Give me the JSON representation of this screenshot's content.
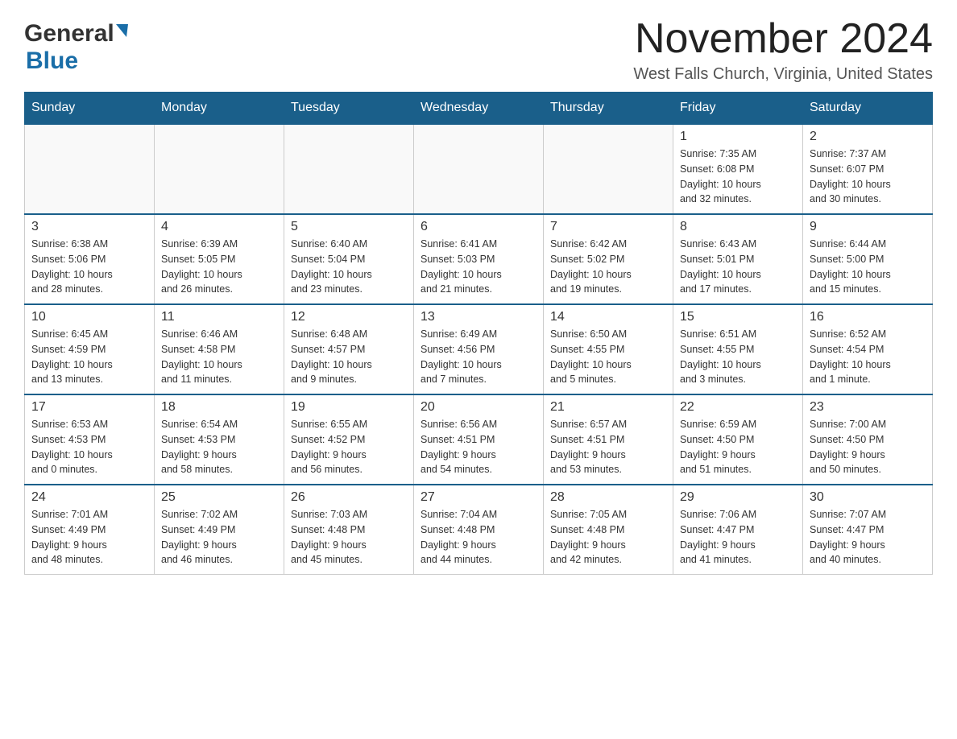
{
  "header": {
    "logo_general": "General",
    "logo_blue": "Blue",
    "month_title": "November 2024",
    "location": "West Falls Church, Virginia, United States"
  },
  "weekdays": [
    "Sunday",
    "Monday",
    "Tuesday",
    "Wednesday",
    "Thursday",
    "Friday",
    "Saturday"
  ],
  "weeks": [
    {
      "days": [
        {
          "date": "",
          "info": ""
        },
        {
          "date": "",
          "info": ""
        },
        {
          "date": "",
          "info": ""
        },
        {
          "date": "",
          "info": ""
        },
        {
          "date": "",
          "info": ""
        },
        {
          "date": "1",
          "info": "Sunrise: 7:35 AM\nSunset: 6:08 PM\nDaylight: 10 hours\nand 32 minutes."
        },
        {
          "date": "2",
          "info": "Sunrise: 7:37 AM\nSunset: 6:07 PM\nDaylight: 10 hours\nand 30 minutes."
        }
      ]
    },
    {
      "days": [
        {
          "date": "3",
          "info": "Sunrise: 6:38 AM\nSunset: 5:06 PM\nDaylight: 10 hours\nand 28 minutes."
        },
        {
          "date": "4",
          "info": "Sunrise: 6:39 AM\nSunset: 5:05 PM\nDaylight: 10 hours\nand 26 minutes."
        },
        {
          "date": "5",
          "info": "Sunrise: 6:40 AM\nSunset: 5:04 PM\nDaylight: 10 hours\nand 23 minutes."
        },
        {
          "date": "6",
          "info": "Sunrise: 6:41 AM\nSunset: 5:03 PM\nDaylight: 10 hours\nand 21 minutes."
        },
        {
          "date": "7",
          "info": "Sunrise: 6:42 AM\nSunset: 5:02 PM\nDaylight: 10 hours\nand 19 minutes."
        },
        {
          "date": "8",
          "info": "Sunrise: 6:43 AM\nSunset: 5:01 PM\nDaylight: 10 hours\nand 17 minutes."
        },
        {
          "date": "9",
          "info": "Sunrise: 6:44 AM\nSunset: 5:00 PM\nDaylight: 10 hours\nand 15 minutes."
        }
      ]
    },
    {
      "days": [
        {
          "date": "10",
          "info": "Sunrise: 6:45 AM\nSunset: 4:59 PM\nDaylight: 10 hours\nand 13 minutes."
        },
        {
          "date": "11",
          "info": "Sunrise: 6:46 AM\nSunset: 4:58 PM\nDaylight: 10 hours\nand 11 minutes."
        },
        {
          "date": "12",
          "info": "Sunrise: 6:48 AM\nSunset: 4:57 PM\nDaylight: 10 hours\nand 9 minutes."
        },
        {
          "date": "13",
          "info": "Sunrise: 6:49 AM\nSunset: 4:56 PM\nDaylight: 10 hours\nand 7 minutes."
        },
        {
          "date": "14",
          "info": "Sunrise: 6:50 AM\nSunset: 4:55 PM\nDaylight: 10 hours\nand 5 minutes."
        },
        {
          "date": "15",
          "info": "Sunrise: 6:51 AM\nSunset: 4:55 PM\nDaylight: 10 hours\nand 3 minutes."
        },
        {
          "date": "16",
          "info": "Sunrise: 6:52 AM\nSunset: 4:54 PM\nDaylight: 10 hours\nand 1 minute."
        }
      ]
    },
    {
      "days": [
        {
          "date": "17",
          "info": "Sunrise: 6:53 AM\nSunset: 4:53 PM\nDaylight: 10 hours\nand 0 minutes."
        },
        {
          "date": "18",
          "info": "Sunrise: 6:54 AM\nSunset: 4:53 PM\nDaylight: 9 hours\nand 58 minutes."
        },
        {
          "date": "19",
          "info": "Sunrise: 6:55 AM\nSunset: 4:52 PM\nDaylight: 9 hours\nand 56 minutes."
        },
        {
          "date": "20",
          "info": "Sunrise: 6:56 AM\nSunset: 4:51 PM\nDaylight: 9 hours\nand 54 minutes."
        },
        {
          "date": "21",
          "info": "Sunrise: 6:57 AM\nSunset: 4:51 PM\nDaylight: 9 hours\nand 53 minutes."
        },
        {
          "date": "22",
          "info": "Sunrise: 6:59 AM\nSunset: 4:50 PM\nDaylight: 9 hours\nand 51 minutes."
        },
        {
          "date": "23",
          "info": "Sunrise: 7:00 AM\nSunset: 4:50 PM\nDaylight: 9 hours\nand 50 minutes."
        }
      ]
    },
    {
      "days": [
        {
          "date": "24",
          "info": "Sunrise: 7:01 AM\nSunset: 4:49 PM\nDaylight: 9 hours\nand 48 minutes."
        },
        {
          "date": "25",
          "info": "Sunrise: 7:02 AM\nSunset: 4:49 PM\nDaylight: 9 hours\nand 46 minutes."
        },
        {
          "date": "26",
          "info": "Sunrise: 7:03 AM\nSunset: 4:48 PM\nDaylight: 9 hours\nand 45 minutes."
        },
        {
          "date": "27",
          "info": "Sunrise: 7:04 AM\nSunset: 4:48 PM\nDaylight: 9 hours\nand 44 minutes."
        },
        {
          "date": "28",
          "info": "Sunrise: 7:05 AM\nSunset: 4:48 PM\nDaylight: 9 hours\nand 42 minutes."
        },
        {
          "date": "29",
          "info": "Sunrise: 7:06 AM\nSunset: 4:47 PM\nDaylight: 9 hours\nand 41 minutes."
        },
        {
          "date": "30",
          "info": "Sunrise: 7:07 AM\nSunset: 4:47 PM\nDaylight: 9 hours\nand 40 minutes."
        }
      ]
    }
  ]
}
